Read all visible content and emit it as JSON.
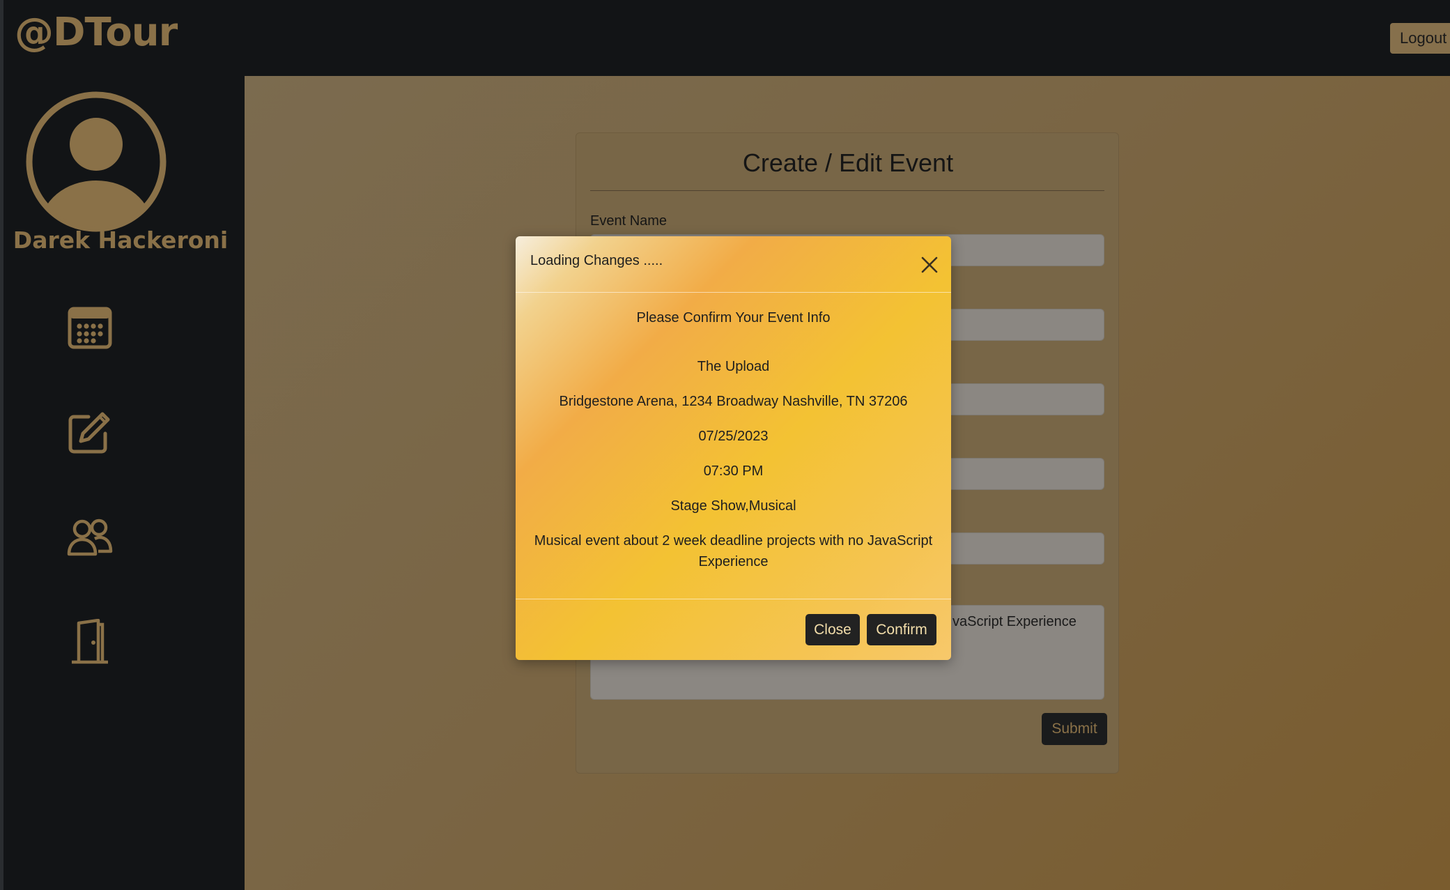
{
  "header": {
    "brand": "@DTour",
    "logout_label": "Logout"
  },
  "sidebar": {
    "user_name": "Darek Hackeroni",
    "items": [
      {
        "icon": "calendar-icon"
      },
      {
        "icon": "edit-icon"
      },
      {
        "icon": "users-icon"
      },
      {
        "icon": "door-icon"
      }
    ]
  },
  "form": {
    "title": "Create / Edit Event",
    "event_name_label": "Event Name",
    "description_visible_text": "vaScript Experience",
    "submit_label": "Submit"
  },
  "modal": {
    "title": "Loading Changes .....",
    "heading": "Please Confirm Your Event Info",
    "event_name": "The Upload",
    "location": "Bridgestone Arena, 1234 Broadway Nashville, TN 37206",
    "date": "07/25/2023",
    "time": "07:30 PM",
    "categories": "Stage Show,Musical",
    "description": "Musical event about 2 week deadline projects with no JavaScript Experience",
    "close_label": "Close",
    "confirm_label": "Confirm"
  },
  "colors": {
    "accent": "#8a7148",
    "background": "#121416",
    "modal_gold": "#f3c233"
  }
}
